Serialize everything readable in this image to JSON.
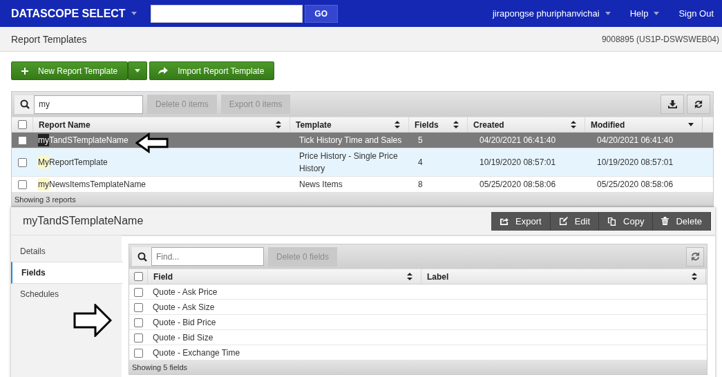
{
  "topbar": {
    "brand": "DATASCOPE SELECT",
    "go": "GO",
    "user": "jirapongse phuriphanvichai",
    "help": "Help",
    "signout": "Sign Out"
  },
  "subheader": {
    "title": "Report Templates",
    "server": "9008895 (US1P-DSWSWEB04)"
  },
  "actions": {
    "new_template": "New Report Template",
    "import_template": "Import Report Template"
  },
  "reports": {
    "search": {
      "value": "my"
    },
    "select_all_checked": false,
    "delete": "Delete 0 items",
    "export": "Export 0 items",
    "columns": [
      {
        "label": "Report Name",
        "sorted": false
      },
      {
        "label": "Template",
        "sorted": false
      },
      {
        "label": "Fields",
        "sorted": false
      },
      {
        "label": "Created",
        "sorted": false
      },
      {
        "label": "Modified",
        "sorted": true
      }
    ],
    "rows": [
      {
        "name_match": "my",
        "name_rest": "TandSTemplateName",
        "template": "Tick History Time and Sales",
        "fields": "5",
        "created": "04/20/2021 06:41:40",
        "modified": "04/20/2021 06:41:40",
        "checked": false,
        "selected": true,
        "hovered": false
      },
      {
        "name_match": "My",
        "name_rest": "ReportTemplate",
        "template": "Price History - Single Price History",
        "fields": "4",
        "created": "10/19/2020 08:57:01",
        "modified": "10/19/2020 08:57:01",
        "checked": false,
        "selected": false,
        "hovered": true
      },
      {
        "name_match": "my",
        "name_rest": "NewsItemsTemplateName",
        "template": "News Items",
        "fields": "8",
        "created": "05/25/2020 08:58:06",
        "modified": "05/25/2020 08:58:06",
        "checked": false,
        "selected": false,
        "hovered": false
      }
    ],
    "footer": "Showing 3 reports"
  },
  "detail": {
    "title": "myTandSTemplateName",
    "buttons": [
      {
        "kind": "export",
        "label": "Export"
      },
      {
        "kind": "edit",
        "label": "Edit"
      },
      {
        "kind": "copy",
        "label": "Copy"
      },
      {
        "kind": "delete",
        "label": "Delete"
      }
    ],
    "tabs": [
      {
        "label": "Details",
        "selected": false
      },
      {
        "label": "Fields",
        "selected": true
      },
      {
        "label": "Schedules",
        "selected": false
      }
    ],
    "fields": {
      "search": {
        "placeholder": "Find..."
      },
      "select_all_checked": false,
      "delete": "Delete 0 fields",
      "columns": [
        {
          "label": "Field"
        },
        {
          "label": "Label"
        }
      ],
      "rows": [
        {
          "field": "Quote - Ask Price",
          "checked": false
        },
        {
          "field": "Quote - Ask Size",
          "checked": false
        },
        {
          "field": "Quote - Bid Price",
          "checked": false
        },
        {
          "field": "Quote - Bid Size",
          "checked": false
        },
        {
          "field": "Quote - Exchange Time",
          "checked": false
        }
      ],
      "footer": "Showing 5 fields"
    }
  }
}
